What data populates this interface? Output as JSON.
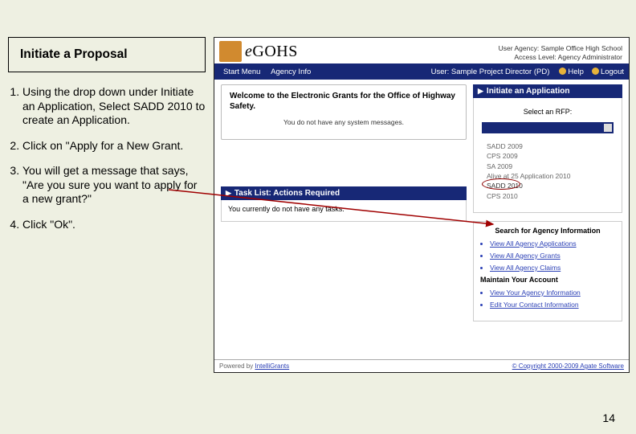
{
  "slide": {
    "title": "Initiate a Proposal",
    "steps": [
      "Using the drop down under Initiate an Application, Select SADD 2010 to create an Application.",
      "Click on \"Apply for a New Grant.",
      "You will get a message that says, \"Are you sure you want to apply for a new grant?\"",
      "Click \"Ok\"."
    ],
    "page_number": "14"
  },
  "app": {
    "brand_prefix": "e",
    "brand_main": "GOHS",
    "header_lines": {
      "l1": "User Agency: Sample Office High School",
      "l2": "Access Level: Agency Administrator"
    },
    "menu": {
      "start": "Start Menu",
      "agency": "Agency Info",
      "user": "User: Sample Project Director (PD)",
      "help": "Help",
      "logout": "Logout"
    },
    "welcome": {
      "title": "Welcome to the Electronic Grants for the Office of Highway Safety.",
      "msg": "You do not have any system messages."
    },
    "tasklist": {
      "head": "Task List: Actions Required",
      "body": "You currently do not have any tasks."
    },
    "initiate": {
      "head": "Initiate an Application",
      "select_label": "Select an RFP:",
      "options": [
        "SADD 2009",
        "CPS 2009",
        "SA 2009",
        "Alive at 25 Application 2010",
        "SADD 2010",
        "CPS 2010"
      ]
    },
    "search": {
      "head": "Search for Agency Information",
      "links": [
        "View All Agency Applications",
        "View All Agency Grants",
        "View All Agency Claims"
      ]
    },
    "maintain": {
      "head": "Maintain Your Account",
      "links": [
        "View Your Agency Information",
        "Edit Your Contact Information"
      ]
    },
    "footer": {
      "left_text": "Powered by ",
      "left_link": "IntelliGrants",
      "right": "© Copyright 2000-2009 Agate Software"
    }
  }
}
